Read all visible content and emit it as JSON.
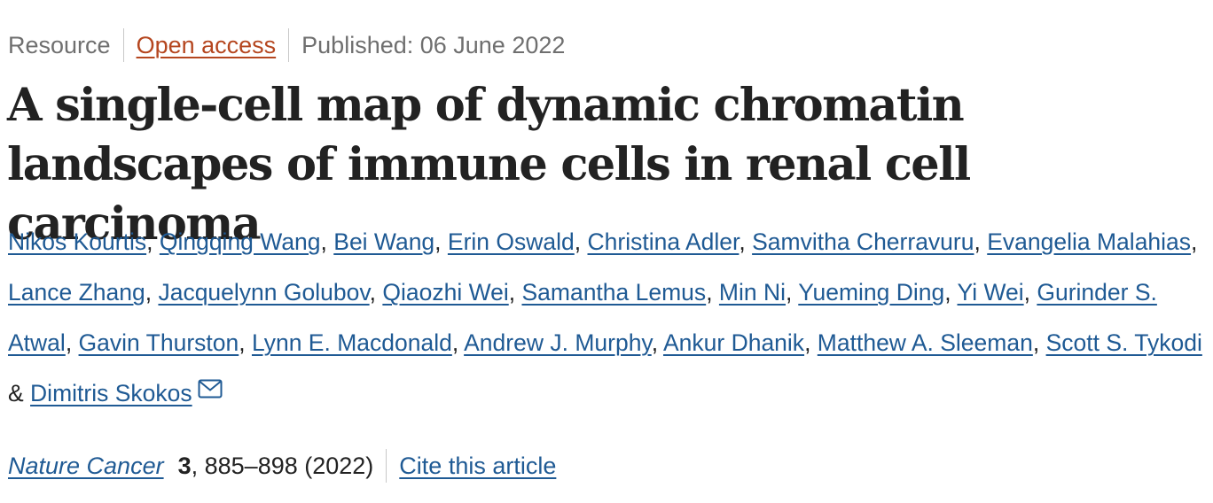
{
  "header": {
    "article_type": "Resource",
    "access_label": "Open access",
    "published_label": "Published: 06 June 2022"
  },
  "title": "A single-cell map of dynamic chromatin landscapes of immune cells in renal cell carcinoma",
  "authors": {
    "names": [
      "Nikos Kourtis",
      "Qingqing Wang",
      "Bei Wang",
      "Erin Oswald",
      "Christina Adler",
      "Samvitha Cherravuru",
      "Evangelia Malahias",
      "Lance Zhang",
      "Jacquelynn Golubov",
      "Qiaozhi Wei",
      "Samantha Lemus",
      "Min Ni",
      "Yueming Ding",
      "Yi Wei",
      "Gurinder S. Atwal",
      "Gavin Thurston",
      "Lynn E. Macdonald",
      "Andrew J. Murphy",
      "Ankur Dhanik",
      "Matthew A. Sleeman",
      "Scott S. Tykodi",
      "Dimitris Skokos"
    ],
    "separator": ", ",
    "final_separator": " & ",
    "corresponding_icon": "mail-icon"
  },
  "citation": {
    "journal": "Nature Cancer",
    "volume": "3",
    "pages_year": ", 885–898 (2022)",
    "cite_label": "Cite this article"
  },
  "colors": {
    "link_blue": "#1f5a94",
    "open_access_orange": "#b5461f",
    "meta_gray": "#6f6f6f",
    "text": "#222222"
  }
}
